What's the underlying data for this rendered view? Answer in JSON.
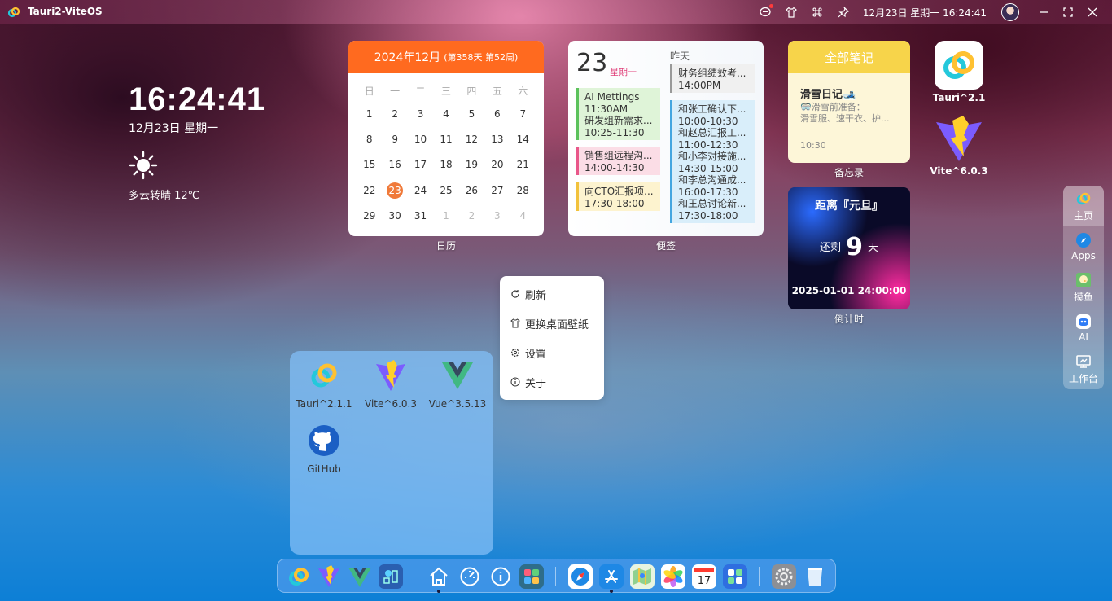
{
  "topbar": {
    "title": "Tauri2-ViteOS",
    "datetime": "12月23日 星期一 16:24:41"
  },
  "clock": {
    "time": "16:24:41",
    "date": "12月23日 星期一",
    "weather": "多云转晴 12℃"
  },
  "calendar": {
    "title": "2024年12月",
    "sub": "(第358天 第52周)",
    "label": "日历",
    "weekdays": [
      "日",
      "一",
      "二",
      "三",
      "四",
      "五",
      "六"
    ],
    "days": [
      [
        "1",
        "2",
        "3",
        "4",
        "5",
        "6",
        "7"
      ],
      [
        "8",
        "9",
        "10",
        "11",
        "12",
        "13",
        "14"
      ],
      [
        "15",
        "16",
        "17",
        "18",
        "19",
        "20",
        "21"
      ],
      [
        "22",
        "23",
        "24",
        "25",
        "26",
        "27",
        "28"
      ],
      [
        "29",
        "30",
        "31",
        "1",
        "2",
        "3",
        "4"
      ]
    ],
    "today": "23"
  },
  "memo": {
    "label": "便签",
    "day": "23",
    "weekday": "星期一",
    "yesterday": "昨天",
    "events_left": [
      {
        "lines": [
          "AI Mettings",
          "11:30AM",
          "研发组新需求...",
          "10:25-11:30"
        ],
        "color": "green"
      },
      {
        "lines": [
          "销售组远程沟...",
          "14:00-14:30"
        ],
        "color": "pink"
      },
      {
        "lines": [
          "向CTO汇报项...",
          "17:30-18:00"
        ],
        "color": "yellow"
      }
    ],
    "events_right": [
      {
        "lines": [
          "财务组绩效考...",
          "14:00PM"
        ],
        "color": "gray"
      },
      {
        "lines": [
          "和张工确认下...",
          "10:00-10:30",
          "和赵总汇报工...",
          "11:00-12:30",
          "和小李对接施...",
          "14:30-15:00",
          "和李总沟通成...",
          "16:00-17:30",
          "和王总讨论新...",
          "17:30-18:00"
        ],
        "color": "blue"
      }
    ]
  },
  "note": {
    "header": "全部笔记",
    "title": "滑雪日记🎿",
    "line1": "🥽滑雪前准备：",
    "line2": "滑雪服、速干衣、护...",
    "time": "10:30",
    "label": "备忘录"
  },
  "countdown": {
    "title": "距离『元旦』",
    "prefix": "还剩",
    "days": "9",
    "suffix": "天",
    "date": "2025-01-01 24:00:00",
    "label": "倒计时"
  },
  "desktop_icons": [
    {
      "label": "Tauri^2.1"
    },
    {
      "label": "Vite^6.0.3"
    }
  ],
  "side_dock": [
    {
      "label": "主页"
    },
    {
      "label": "Apps"
    },
    {
      "label": "摸鱼"
    },
    {
      "label": "AI"
    },
    {
      "label": "工作台"
    }
  ],
  "context_menu": [
    {
      "label": "刷新",
      "icon": "refresh-icon"
    },
    {
      "label": "更换桌面壁纸",
      "icon": "shirt-icon"
    },
    {
      "label": "设置",
      "icon": "gear-icon"
    },
    {
      "label": "关于",
      "icon": "info-icon"
    }
  ],
  "folder": [
    {
      "label": "Tauri^2.1.1"
    },
    {
      "label": "Vite^6.0.3"
    },
    {
      "label": "Vue^3.5.13"
    },
    {
      "label": "GitHub"
    }
  ],
  "colors": {
    "calendar_header": "#ff6a1f",
    "note_header": "#f7d44a",
    "today": "#f07a3a"
  }
}
